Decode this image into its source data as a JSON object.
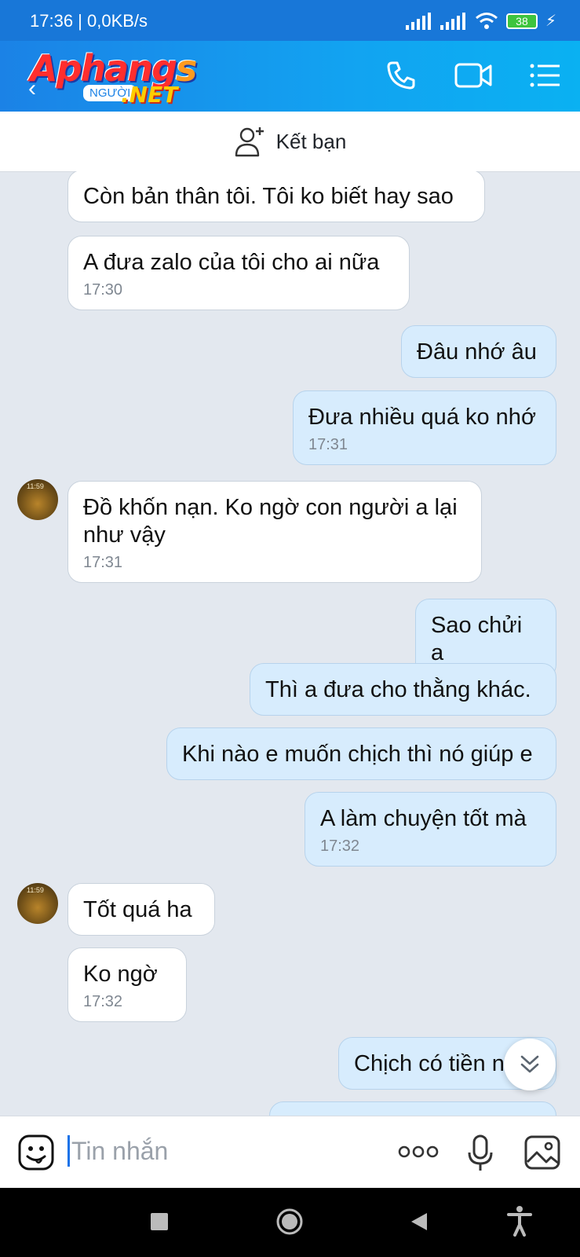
{
  "status_bar": {
    "time_speed": "17:36 | 0,0KB/s",
    "battery": "38"
  },
  "header": {
    "logo_brand": "Aphangs",
    "logo_brand_main": "Aphang",
    "logo_brand_end": "s",
    "logo_tag": "NGƯỜI",
    "logo_net": ".NET"
  },
  "friend_bar": {
    "label": "Kết bạn"
  },
  "messages": [
    {
      "side": "in",
      "text": "Còn bản thân tôi. Tôi ko biết hay sao",
      "time": ""
    },
    {
      "side": "in",
      "text": "A đưa zalo của tôi cho ai nữa",
      "time": "17:30"
    },
    {
      "side": "out",
      "text": "Đâu nhớ âu",
      "time": ""
    },
    {
      "side": "out",
      "text": "Đưa nhiều quá ko nhớ",
      "time": "17:31"
    },
    {
      "side": "in",
      "text": "Đồ khốn nạn. Ko ngờ con người a lại như vậy",
      "time": "17:31",
      "avatar_time": "11:59"
    },
    {
      "side": "out",
      "text": "Sao chửi a",
      "time": ""
    },
    {
      "side": "out",
      "text": "Thì a đưa cho thằng khác.",
      "time": ""
    },
    {
      "side": "out",
      "text": "Khi nào e muốn chịch thì nó giúp e",
      "time": ""
    },
    {
      "side": "out",
      "text": "A làm chuyện tốt mà",
      "time": "17:32"
    },
    {
      "side": "in",
      "text": "Tốt quá ha",
      "time": "",
      "avatar_time": "11:59"
    },
    {
      "side": "in",
      "text": "Ko ngờ",
      "time": "17:32"
    },
    {
      "side": "out",
      "text": "Chịch có tiền n",
      "time": ""
    }
  ],
  "composer": {
    "placeholder": "Tin nhắn"
  },
  "colors": {
    "appbar": "#1b82e6",
    "out_bubble": "#d7ecfd",
    "in_bubble": "#ffffff",
    "chat_bg": "#e3e8ef"
  }
}
